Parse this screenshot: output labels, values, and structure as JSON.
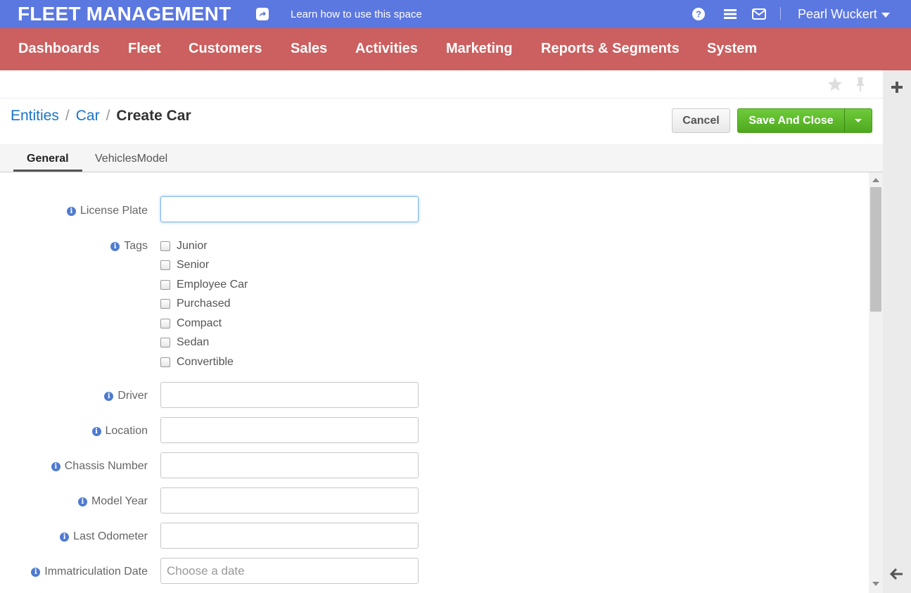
{
  "header": {
    "app_title": "FLEET MANAGEMENT",
    "learn_link": "Learn how to use this space",
    "user_name": "Pearl Wuckert",
    "icons": [
      "share-icon",
      "help-icon",
      "menu-icon",
      "mail-icon"
    ]
  },
  "nav": {
    "items": [
      "Dashboards",
      "Fleet",
      "Customers",
      "Sales",
      "Activities",
      "Marketing",
      "Reports & Segments",
      "System"
    ]
  },
  "breadcrumb": {
    "entities": "Entities",
    "car": "Car",
    "current": "Create Car",
    "separator": "/"
  },
  "actions": {
    "cancel": "Cancel",
    "save_and_close": "Save And Close"
  },
  "tabs": {
    "general": "General",
    "vehicles_model": "VehiclesModel"
  },
  "form": {
    "license_plate": {
      "label": "License Plate",
      "value": ""
    },
    "tags": {
      "label": "Tags",
      "options": [
        "Junior",
        "Senior",
        "Employee Car",
        "Purchased",
        "Compact",
        "Sedan",
        "Convertible"
      ]
    },
    "driver": {
      "label": "Driver",
      "value": ""
    },
    "location": {
      "label": "Location",
      "value": ""
    },
    "chassis_number": {
      "label": "Chassis Number",
      "value": ""
    },
    "model_year": {
      "label": "Model Year",
      "value": ""
    },
    "last_odometer": {
      "label": "Last Odometer",
      "value": ""
    },
    "immatriculation_date": {
      "label": "Immatriculation Date",
      "placeholder": "Choose a date"
    }
  },
  "colors": {
    "topbar": "#5b77e0",
    "mainnav": "#cc5f5f",
    "save_button": "#5cb82a",
    "link": "#1a74c9"
  }
}
